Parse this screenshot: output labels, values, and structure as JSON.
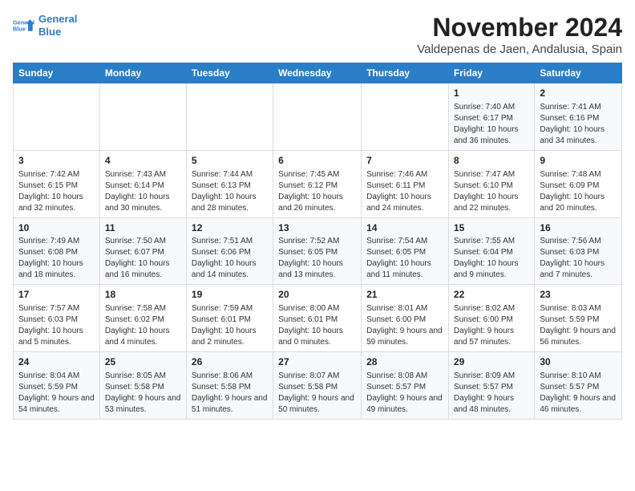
{
  "header": {
    "logo_line1": "General",
    "logo_line2": "Blue",
    "title": "November 2024",
    "subtitle": "Valdepenas de Jaen, Andalusia, Spain"
  },
  "days_of_week": [
    "Sunday",
    "Monday",
    "Tuesday",
    "Wednesday",
    "Thursday",
    "Friday",
    "Saturday"
  ],
  "weeks": [
    [
      {
        "day": "",
        "content": ""
      },
      {
        "day": "",
        "content": ""
      },
      {
        "day": "",
        "content": ""
      },
      {
        "day": "",
        "content": ""
      },
      {
        "day": "",
        "content": ""
      },
      {
        "day": "1",
        "content": "Sunrise: 7:40 AM\nSunset: 6:17 PM\nDaylight: 10 hours and 36 minutes."
      },
      {
        "day": "2",
        "content": "Sunrise: 7:41 AM\nSunset: 6:16 PM\nDaylight: 10 hours and 34 minutes."
      }
    ],
    [
      {
        "day": "3",
        "content": "Sunrise: 7:42 AM\nSunset: 6:15 PM\nDaylight: 10 hours and 32 minutes."
      },
      {
        "day": "4",
        "content": "Sunrise: 7:43 AM\nSunset: 6:14 PM\nDaylight: 10 hours and 30 minutes."
      },
      {
        "day": "5",
        "content": "Sunrise: 7:44 AM\nSunset: 6:13 PM\nDaylight: 10 hours and 28 minutes."
      },
      {
        "day": "6",
        "content": "Sunrise: 7:45 AM\nSunset: 6:12 PM\nDaylight: 10 hours and 26 minutes."
      },
      {
        "day": "7",
        "content": "Sunrise: 7:46 AM\nSunset: 6:11 PM\nDaylight: 10 hours and 24 minutes."
      },
      {
        "day": "8",
        "content": "Sunrise: 7:47 AM\nSunset: 6:10 PM\nDaylight: 10 hours and 22 minutes."
      },
      {
        "day": "9",
        "content": "Sunrise: 7:48 AM\nSunset: 6:09 PM\nDaylight: 10 hours and 20 minutes."
      }
    ],
    [
      {
        "day": "10",
        "content": "Sunrise: 7:49 AM\nSunset: 6:08 PM\nDaylight: 10 hours and 18 minutes."
      },
      {
        "day": "11",
        "content": "Sunrise: 7:50 AM\nSunset: 6:07 PM\nDaylight: 10 hours and 16 minutes."
      },
      {
        "day": "12",
        "content": "Sunrise: 7:51 AM\nSunset: 6:06 PM\nDaylight: 10 hours and 14 minutes."
      },
      {
        "day": "13",
        "content": "Sunrise: 7:52 AM\nSunset: 6:05 PM\nDaylight: 10 hours and 13 minutes."
      },
      {
        "day": "14",
        "content": "Sunrise: 7:54 AM\nSunset: 6:05 PM\nDaylight: 10 hours and 11 minutes."
      },
      {
        "day": "15",
        "content": "Sunrise: 7:55 AM\nSunset: 6:04 PM\nDaylight: 10 hours and 9 minutes."
      },
      {
        "day": "16",
        "content": "Sunrise: 7:56 AM\nSunset: 6:03 PM\nDaylight: 10 hours and 7 minutes."
      }
    ],
    [
      {
        "day": "17",
        "content": "Sunrise: 7:57 AM\nSunset: 6:03 PM\nDaylight: 10 hours and 5 minutes."
      },
      {
        "day": "18",
        "content": "Sunrise: 7:58 AM\nSunset: 6:02 PM\nDaylight: 10 hours and 4 minutes."
      },
      {
        "day": "19",
        "content": "Sunrise: 7:59 AM\nSunset: 6:01 PM\nDaylight: 10 hours and 2 minutes."
      },
      {
        "day": "20",
        "content": "Sunrise: 8:00 AM\nSunset: 6:01 PM\nDaylight: 10 hours and 0 minutes."
      },
      {
        "day": "21",
        "content": "Sunrise: 8:01 AM\nSunset: 6:00 PM\nDaylight: 9 hours and 59 minutes."
      },
      {
        "day": "22",
        "content": "Sunrise: 8:02 AM\nSunset: 6:00 PM\nDaylight: 9 hours and 57 minutes."
      },
      {
        "day": "23",
        "content": "Sunrise: 8:03 AM\nSunset: 5:59 PM\nDaylight: 9 hours and 56 minutes."
      }
    ],
    [
      {
        "day": "24",
        "content": "Sunrise: 8:04 AM\nSunset: 5:59 PM\nDaylight: 9 hours and 54 minutes."
      },
      {
        "day": "25",
        "content": "Sunrise: 8:05 AM\nSunset: 5:58 PM\nDaylight: 9 hours and 53 minutes."
      },
      {
        "day": "26",
        "content": "Sunrise: 8:06 AM\nSunset: 5:58 PM\nDaylight: 9 hours and 51 minutes."
      },
      {
        "day": "27",
        "content": "Sunrise: 8:07 AM\nSunset: 5:58 PM\nDaylight: 9 hours and 50 minutes."
      },
      {
        "day": "28",
        "content": "Sunrise: 8:08 AM\nSunset: 5:57 PM\nDaylight: 9 hours and 49 minutes."
      },
      {
        "day": "29",
        "content": "Sunrise: 8:09 AM\nSunset: 5:57 PM\nDaylight: 9 hours and 48 minutes."
      },
      {
        "day": "30",
        "content": "Sunrise: 8:10 AM\nSunset: 5:57 PM\nDaylight: 9 hours and 46 minutes."
      }
    ]
  ]
}
